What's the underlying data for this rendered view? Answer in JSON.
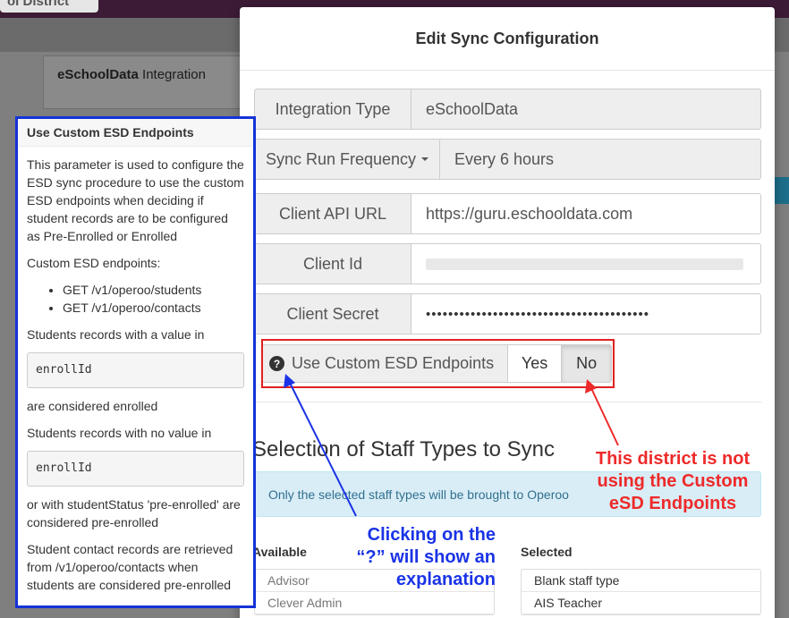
{
  "app": {
    "district_tab_label": "ol District",
    "integration_panel": {
      "brand": "eSchoolData",
      "title_suffix": " Integration"
    }
  },
  "modal": {
    "title": "Edit Sync Configuration",
    "fields": {
      "integration_type": {
        "label": "Integration Type",
        "value": "eSchoolData"
      },
      "sync_run_frequency": {
        "label": "Sync Run Frequency",
        "value": "Every 6 hours"
      },
      "client_api_url": {
        "label": "Client API URL",
        "value": "https://guru.eschooldata.com"
      },
      "client_id": {
        "label": "Client Id",
        "value": ""
      },
      "client_secret": {
        "label": "Client Secret",
        "value": "••••••••••••••••••••••••••••••••••••••••"
      }
    },
    "custom_esd": {
      "help_icon": "question-circle-icon",
      "label": "Use Custom ESD Endpoints",
      "yes_label": "Yes",
      "no_label": "No",
      "selected": "No"
    },
    "staff_section": {
      "title": "Selection of Staff Types to Sync",
      "info": "Only the selected staff types will be brought to Operoo",
      "available_header": "Available",
      "selected_header": "Selected",
      "available_items": [
        "Advisor",
        "Clever Admin"
      ],
      "selected_items": [
        "Blank staff type",
        "AIS Teacher"
      ]
    }
  },
  "popover": {
    "title": "Use Custom ESD Endpoints",
    "para1": "This parameter is used to configure the ESD sync procedure to use the custom ESD endpoints when deciding if student records are to be configured as Pre-Enrolled or Enrolled",
    "endpoints_heading": "Custom ESD endpoints:",
    "endpoints": [
      "GET /v1/operoo/students",
      "GET /v1/operoo/contacts"
    ],
    "with_value": "Students records with a value in",
    "code1": "enrollId",
    "considered_enrolled": "are considered enrolled",
    "no_value": "Students records with no value in",
    "code2": "enrollId",
    "status_text": "or with studentStatus 'pre-enrolled' are considered pre-enrolled",
    "contacts_text": "Student contact records are retrieved from /v1/operoo/contacts when students are considered pre-enrolled"
  },
  "annotations": {
    "red_text": "This district is not using the Custom eSD Endpoints",
    "blue_text": "Clicking on the “?” will show an explanation",
    "red_color": "#ee2a2a",
    "blue_color": "#1a33e6"
  }
}
